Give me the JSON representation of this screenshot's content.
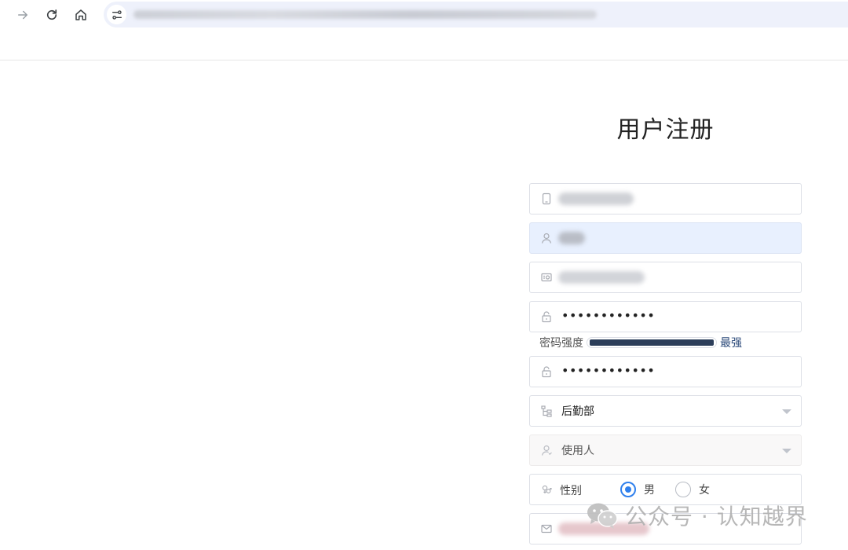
{
  "form": {
    "title": "用户注册",
    "password_strength": {
      "label": "密码强度",
      "level": "最强",
      "fill_fraction": 1.0
    },
    "password_mask": "••••••••••••",
    "confirm_password_mask": "••••••••••••",
    "department": "后勤部",
    "role": "使用人",
    "gender": {
      "label": "性别",
      "options": [
        "男",
        "女"
      ],
      "selected": "男"
    }
  },
  "watermark": {
    "text": "公众号 · 认知越界"
  },
  "colors": {
    "accent": "#2f80ed",
    "strength_fill": "#2c3e5a",
    "autofill_bg": "#e8f0fe"
  },
  "icons": {
    "phone": "phone-icon",
    "user": "user-icon",
    "id": "id-card-icon",
    "lock": "lock-icon",
    "department": "tree-icon",
    "role": "user-role-icon",
    "gender": "gender-icon",
    "email": "email-icon"
  }
}
